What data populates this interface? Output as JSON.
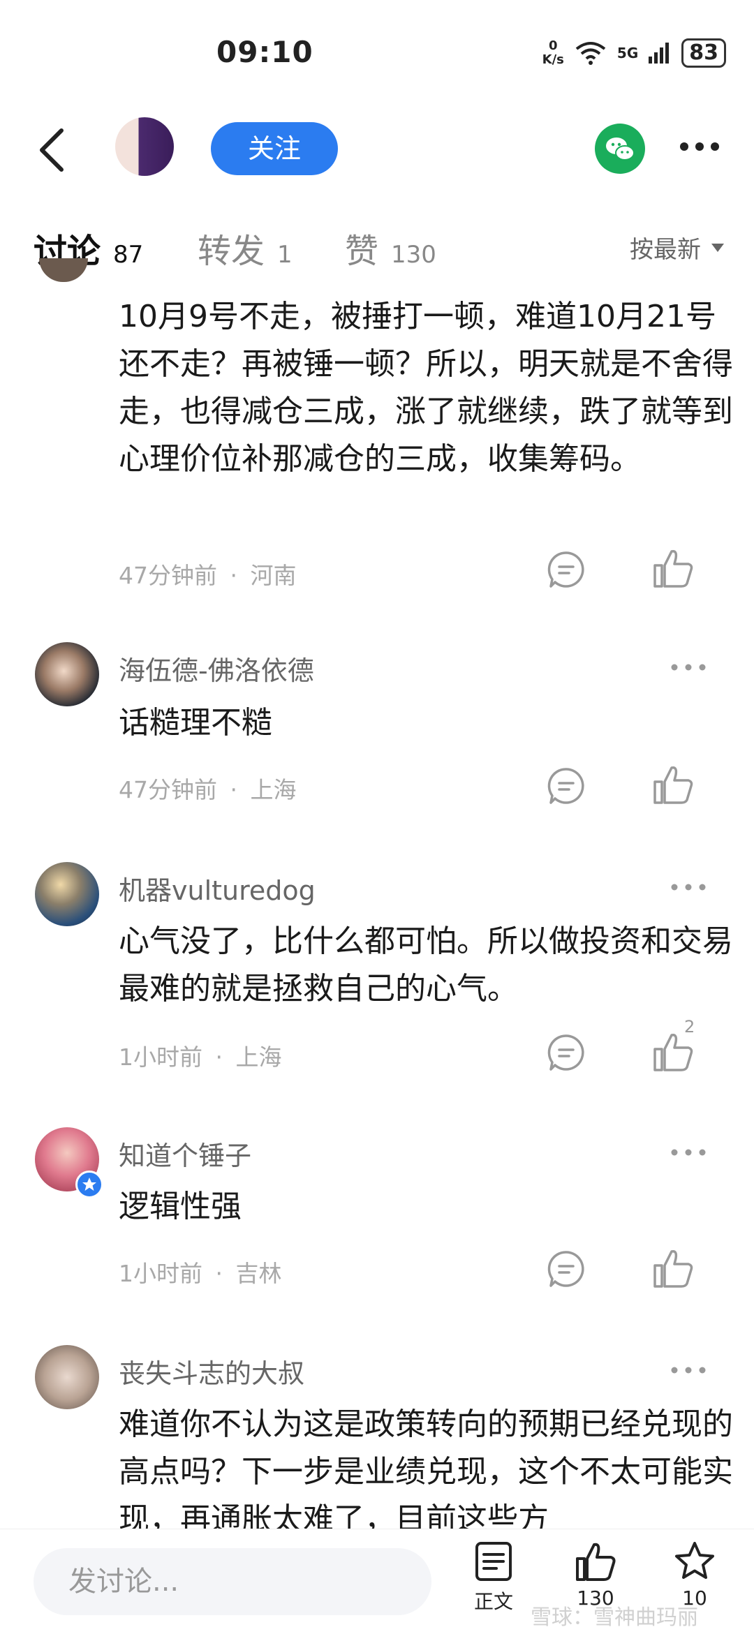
{
  "status_bar": {
    "time": "09:10",
    "net_speed_value": "0",
    "net_speed_unit": "K/s",
    "network": "5G",
    "battery": "83"
  },
  "header": {
    "follow_label": "关注"
  },
  "tabs": [
    {
      "label": "讨论",
      "count": "87",
      "active": true
    },
    {
      "label": "转发",
      "count": "1",
      "active": false
    },
    {
      "label": "赞",
      "count": "130",
      "active": false
    }
  ],
  "sort": {
    "label": "按最新"
  },
  "comments": [
    {
      "name": "",
      "body": "10月9号不走，被捶打一顿，难道10月21号还不走？再被锤一顿？所以，明天就是不舍得走，也得减仓三成，涨了就继续，跌了就等到心理价位补那减仓的三成，收集筹码。",
      "time": "47分钟前",
      "location": "河南",
      "likes": ""
    },
    {
      "name": "海伍德-佛洛依德",
      "body": "话糙理不糙",
      "time": "47分钟前",
      "location": "上海",
      "likes": ""
    },
    {
      "name": "机器vulturedog",
      "body": "心气没了，比什么都可怕。所以做投资和交易最难的就是拯救自己的心气。",
      "time": "1小时前",
      "location": "上海",
      "likes": "2"
    },
    {
      "name": "知道个锤子",
      "body": "逻辑性强",
      "time": "1小时前",
      "location": "吉林",
      "likes": ""
    },
    {
      "name": "丧失斗志的大叔",
      "body": "难道你不认为这是政策转向的预期已经兑现的高点吗？下一步是业绩兑现，这个不太可能实现，再通胀太难了，目前这些方",
      "time": "",
      "location": "",
      "likes": ""
    }
  ],
  "meta_separator": "·",
  "bottom_bar": {
    "input_placeholder": "发讨论...",
    "article_label": "正文",
    "like_count": "130",
    "favorite_count": "10",
    "watermark": "雪球：雪神曲玛丽"
  }
}
